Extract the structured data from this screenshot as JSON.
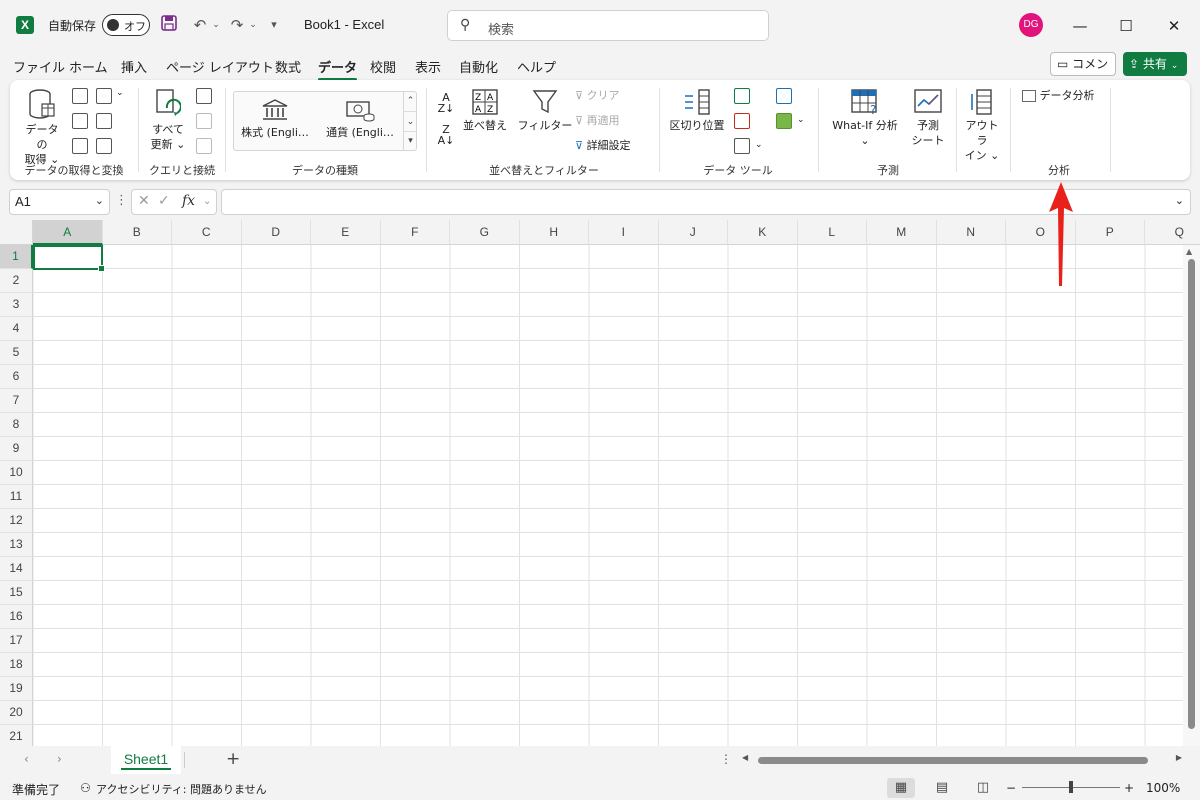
{
  "titlebar": {
    "app_logo": "X",
    "autosave_label": "自動保存",
    "autosave_state": "オフ",
    "doc_title": "Book1  -  Excel",
    "search_placeholder": "検索",
    "avatar_initials": "DG",
    "icons": [
      "save-icon",
      "undo-icon",
      "redo-icon",
      "customize-qat-icon",
      "search-icon",
      "minimize-icon",
      "maximize-icon",
      "close-icon"
    ]
  },
  "menu": {
    "tabs": [
      "ファイル",
      "ホーム",
      "挿入",
      "ページ レイアウト",
      "数式",
      "データ",
      "校閲",
      "表示",
      "自動化",
      "ヘルプ"
    ],
    "active_tab": "データ",
    "comment_label": "コメント",
    "share_label": "共有"
  },
  "ribbon": {
    "get_data": {
      "label_line1": "データの",
      "label_line2": "取得",
      "group": "データの取得と変換"
    },
    "refresh_all": {
      "label_line1": "すべて",
      "label_line2": "更新",
      "group": "クエリと接続"
    },
    "stocks": "株式 (Engli…",
    "currencies": "通貨 (Engli…",
    "data_types_group": "データの種類",
    "sort": "並べ替え",
    "filter": "フィルター",
    "clear": "クリア",
    "reapply": "再適用",
    "advanced": "詳細設定",
    "sort_filter_group": "並べ替えとフィルター",
    "text_to_columns": "区切り位置",
    "data_tools_group": "データ ツール",
    "what_if": "What-If 分析",
    "forecast_line1": "予測",
    "forecast_line2": "シート",
    "forecast_group": "予測",
    "outline_line1": "アウトラ",
    "outline_line2": "イン",
    "data_analysis": "データ分析",
    "analysis_group": "分析"
  },
  "formula_bar": {
    "name_box": "A1",
    "fx_label": "fx",
    "formula": ""
  },
  "grid": {
    "columns": [
      "A",
      "B",
      "C",
      "D",
      "E",
      "F",
      "G",
      "H",
      "I",
      "J",
      "K",
      "L",
      "M",
      "N",
      "O",
      "P",
      "Q"
    ],
    "rows": [
      "1",
      "2",
      "3",
      "4",
      "5",
      "6",
      "7",
      "8",
      "9",
      "10",
      "11",
      "12",
      "13",
      "14",
      "15",
      "16",
      "17",
      "18",
      "19",
      "20",
      "21"
    ],
    "active_cell": "A1"
  },
  "sheets": {
    "tabs": [
      "Sheet1"
    ],
    "active": "Sheet1",
    "add_label": "+"
  },
  "statusbar": {
    "ready": "準備完了",
    "accessibility": "アクセシビリティ: 問題ありません",
    "zoom": "100%",
    "zoom_minus": "−",
    "zoom_plus": "+"
  },
  "colors": {
    "accent": "#107c41",
    "annotation_arrow": "#e8221b",
    "avatar": "#e2147c"
  }
}
